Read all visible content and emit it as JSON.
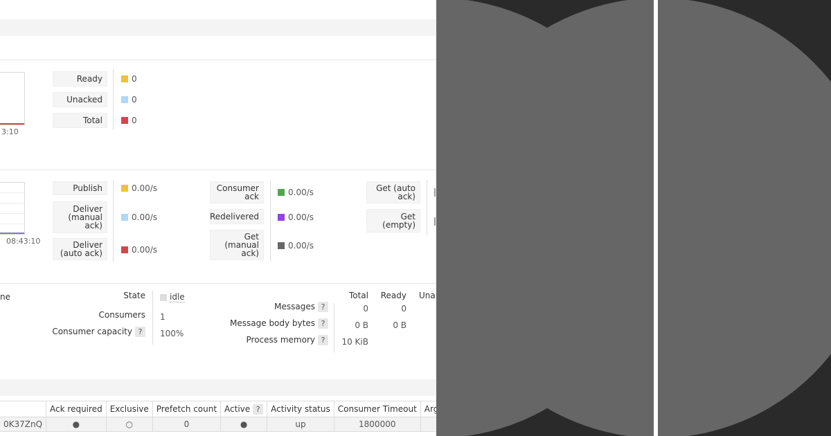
{
  "queued": {
    "axis_time": "3:10",
    "legend": [
      {
        "label": "Ready",
        "value": "0",
        "color": "#edc240"
      },
      {
        "label": "Unacked",
        "value": "0",
        "color": "#afd8f8"
      },
      {
        "label": "Total",
        "value": "0",
        "color": "#cb4b4b"
      }
    ]
  },
  "rates": {
    "axis_time": "08:43:10",
    "col1": [
      {
        "label": "Publish",
        "value": "0.00/s",
        "color": "#edc240"
      },
      {
        "label": "Deliver (manual ack)",
        "value": "0.00/s",
        "color": "#afd8f8"
      },
      {
        "label": "Deliver (auto ack)",
        "value": "0.00/s",
        "color": "#cb4b4b"
      }
    ],
    "col2": [
      {
        "label": "Consumer ack",
        "value": "0.00/s",
        "color": "#4da74d"
      },
      {
        "label": "Redelivered",
        "value": "0.00/s",
        "color": "#9440ed"
      },
      {
        "label": "Get (manual ack)",
        "value": "0.00/s",
        "color": "#666666"
      }
    ],
    "col3": [
      {
        "label": "Get (auto ack)"
      },
      {
        "label": "Get (empty)"
      }
    ]
  },
  "details": {
    "cut_heading": "ne",
    "state_label": "State",
    "state_value": "idle",
    "consumers_label": "Consumers",
    "consumers_value": "1",
    "capacity_label": "Consumer capacity",
    "capacity_value": "100%",
    "help": "?",
    "stats_headers": [
      "Total",
      "Ready",
      "Una"
    ],
    "messages_label": "Messages",
    "messages_total": "0",
    "messages_ready": "0",
    "body_label": "Message body bytes",
    "body_total": "0 B",
    "body_ready": "0 B",
    "memory_label": "Process memory",
    "memory_total": "10 KiB"
  },
  "consumers_table": {
    "headers": [
      "Ack required",
      "Exclusive",
      "Prefetch count",
      "Active",
      "Activity status",
      "Consumer Timeout",
      "Argu"
    ],
    "active_help": "?",
    "row": {
      "tag": "0K37ZnQ",
      "ack_required": "●",
      "exclusive": "○",
      "prefetch": "0",
      "active": "●",
      "activity_status": "up",
      "timeout": "1800000"
    }
  },
  "colors": {
    "side_bg": "#2a2a2a",
    "circle": "#666666"
  }
}
